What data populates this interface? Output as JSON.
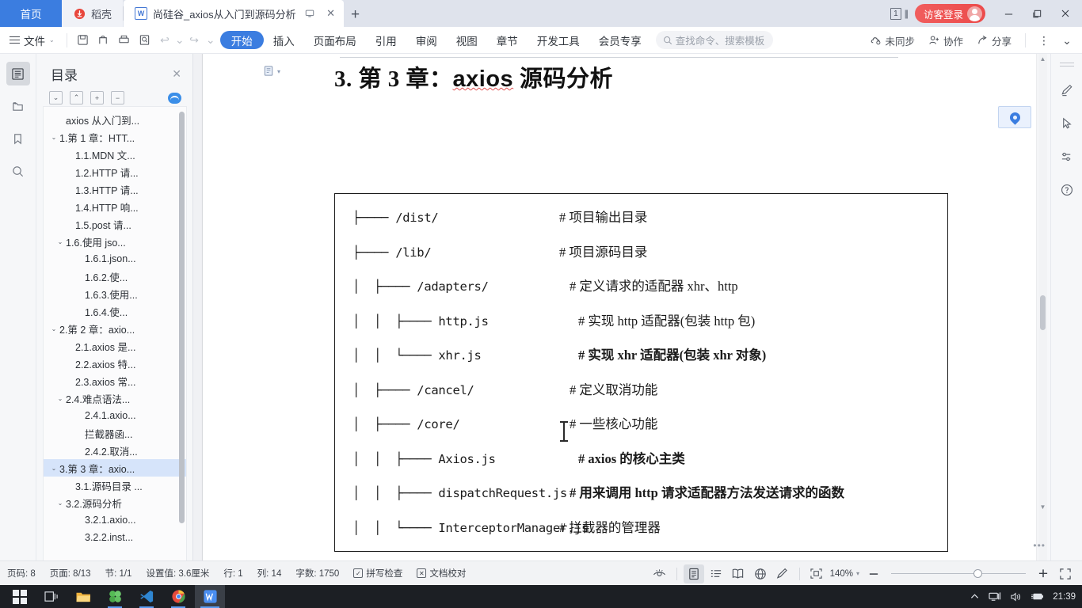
{
  "tabbar": {
    "home_label": "首页",
    "tabs": [
      {
        "label": "稻壳",
        "icon": "dock-icon"
      },
      {
        "label": "尚硅谷_axios从入门到源码分析",
        "icon": "wps-writer-icon"
      }
    ],
    "new_tab_label": "+",
    "page_count": "1",
    "login_label": "访客登录",
    "window_min": "—",
    "window_max": "❐",
    "window_close": "✕"
  },
  "ribbon": {
    "file_label": "文件",
    "quick_icons": [
      "save-icon",
      "print-preview-icon",
      "print-icon",
      "find-icon",
      "undo-icon",
      "redo-icon",
      "customize-icon"
    ],
    "tabs": [
      {
        "label": "开始",
        "selected": true
      },
      {
        "label": "插入",
        "selected": false
      },
      {
        "label": "页面布局",
        "selected": false
      },
      {
        "label": "引用",
        "selected": false
      },
      {
        "label": "审阅",
        "selected": false
      },
      {
        "label": "视图",
        "selected": false
      },
      {
        "label": "章节",
        "selected": false
      },
      {
        "label": "开发工具",
        "selected": false
      },
      {
        "label": "会员专享",
        "selected": false
      }
    ],
    "search_placeholder": "查找命令、搜索模板",
    "sync_label": "未同步",
    "collab_label": "协作",
    "share_label": "分享",
    "more_label": "⋮",
    "collapse_label": "⌄"
  },
  "left_rail": [
    {
      "name": "outline-icon",
      "active": true
    },
    {
      "name": "folder-icon",
      "active": false
    },
    {
      "name": "bookmark-icon",
      "active": false
    },
    {
      "name": "search-icon",
      "active": false
    }
  ],
  "toc": {
    "title": "目录",
    "close_label": "✕",
    "tools": [
      "expand-down-icon",
      "collapse-up-icon",
      "plus-icon",
      "minus-icon",
      "sync-toc-icon"
    ],
    "items": [
      {
        "label": "axios 从入门到...",
        "indent": 1,
        "chevron": "",
        "selected": false
      },
      {
        "label": "1.第 1 章：HTT...",
        "indent": 0,
        "chevron": "⌄",
        "selected": false
      },
      {
        "label": "1.1.MDN 文...",
        "indent": 2,
        "chevron": "",
        "selected": false
      },
      {
        "label": "1.2.HTTP 请...",
        "indent": 2,
        "chevron": "",
        "selected": false
      },
      {
        "label": "1.3.HTTP 请...",
        "indent": 2,
        "chevron": "",
        "selected": false
      },
      {
        "label": "1.4.HTTP 响...",
        "indent": 2,
        "chevron": "",
        "selected": false
      },
      {
        "label": "1.5.post 请...",
        "indent": 2,
        "chevron": "",
        "selected": false
      },
      {
        "label": "1.6.使用 jso...",
        "indent": 1,
        "chevron": "⌄",
        "selected": false
      },
      {
        "label": "1.6.1.json...",
        "indent": 3,
        "chevron": "",
        "selected": false
      },
      {
        "label": "1.6.2.使...",
        "indent": 3,
        "chevron": "",
        "selected": false
      },
      {
        "label": "1.6.3.使用...",
        "indent": 3,
        "chevron": "",
        "selected": false
      },
      {
        "label": "1.6.4.使...",
        "indent": 3,
        "chevron": "",
        "selected": false
      },
      {
        "label": "2.第 2 章：axio...",
        "indent": 0,
        "chevron": "⌄",
        "selected": false
      },
      {
        "label": "2.1.axios 是...",
        "indent": 2,
        "chevron": "",
        "selected": false
      },
      {
        "label": "2.2.axios 特...",
        "indent": 2,
        "chevron": "",
        "selected": false
      },
      {
        "label": "2.3.axios 常...",
        "indent": 2,
        "chevron": "",
        "selected": false
      },
      {
        "label": "2.4.难点语法...",
        "indent": 1,
        "chevron": "⌄",
        "selected": false
      },
      {
        "label": "2.4.1.axio...",
        "indent": 3,
        "chevron": "",
        "selected": false
      },
      {
        "label": "拦截器函...",
        "indent": 3,
        "chevron": "",
        "selected": false
      },
      {
        "label": "2.4.2.取消...",
        "indent": 3,
        "chevron": "",
        "selected": false
      },
      {
        "label": "3.第 3 章：axio...",
        "indent": 0,
        "chevron": "⌄",
        "selected": true
      },
      {
        "label": "3.1.源码目录 ...",
        "indent": 2,
        "chevron": "",
        "selected": false
      },
      {
        "label": "3.2.源码分析",
        "indent": 1,
        "chevron": "⌄",
        "selected": false
      },
      {
        "label": "3.2.1.axio...",
        "indent": 3,
        "chevron": "",
        "selected": false
      },
      {
        "label": "3.2.2.inst...",
        "indent": 3,
        "chevron": "",
        "selected": false
      }
    ]
  },
  "document": {
    "heading": "3. 第 3 章：",
    "heading_en": "axios",
    "heading_tail": " 源码分析",
    "code_rows": [
      {
        "tree": "├──── /dist/",
        "comment": "# 项目输出目录",
        "bold": false,
        "cmt_indent": 0
      },
      {
        "tree": "├──── /lib/",
        "comment": "# 项目源码目录",
        "bold": false,
        "cmt_indent": 0
      },
      {
        "tree": "│  ├──── /adapters/",
        "comment": "# 定义请求的适配器 xhr、http",
        "bold": false,
        "cmt_indent": 1
      },
      {
        "tree": "│  │  ├──── http.js",
        "comment": "# 实现 http 适配器(包装 http 包)",
        "bold": false,
        "cmt_indent": 2
      },
      {
        "tree": "│  │  └──── xhr.js",
        "comment": "# 实现 xhr 适配器(包装 xhr 对象)",
        "bold": true,
        "cmt_indent": 2
      },
      {
        "tree": "│  ├──── /cancel/",
        "comment": "# 定义取消功能",
        "bold": false,
        "cmt_indent": 1
      },
      {
        "tree": "│  ├──── /core/",
        "comment": "# 一些核心功能",
        "bold": false,
        "cmt_indent": 1
      },
      {
        "tree": "│  │  ├──── Axios.js",
        "comment": "# axios 的核心主类",
        "bold": true,
        "cmt_indent": 2
      },
      {
        "tree": "│  │  ├──── dispatchRequest.js",
        "comment": "# 用来调用 http 请求适配器方法发送请求的函数",
        "bold": true,
        "cmt_indent": 1
      },
      {
        "tree": "│  │  └──── InterceptorManager.js",
        "comment": "# 拦截器的管理器",
        "bold": false,
        "cmt_indent": 0
      }
    ]
  },
  "right_rail": [
    {
      "name": "pen-highlight-icon"
    },
    {
      "name": "cursor-select-icon"
    },
    {
      "name": "settings-sliders-icon"
    },
    {
      "name": "help-circle-icon"
    }
  ],
  "status_bar": {
    "items": [
      {
        "label": "页码: 8"
      },
      {
        "label": "页面: 8/13"
      },
      {
        "label": "节: 1/1"
      },
      {
        "label": "设置值: 3.6厘米"
      },
      {
        "label": "行: 1"
      },
      {
        "label": "列: 14"
      },
      {
        "label": "字数: 1750"
      }
    ],
    "spellcheck_label": "拼写检查",
    "proofread_label": "文档校对",
    "view_icons": [
      "eye-icon",
      "page-view-icon",
      "outline-view-icon",
      "book-view-icon",
      "web-view-icon",
      "edit-view-icon"
    ],
    "fit_icon": "fit-page-icon",
    "zoom_level": "140%",
    "zoom_out": "—",
    "zoom_in": "+",
    "fullscreen_icon": "fullscreen-icon"
  },
  "taskbar": {
    "items": [
      "start-icon",
      "task-view-icon",
      "file-explorer-icon",
      "clover-app-icon",
      "vscode-icon",
      "chrome-icon",
      "wps-writer-icon"
    ],
    "tray": [
      "chevron-up-icon",
      "network-icon",
      "volume-icon",
      "battery-icon"
    ],
    "clock": "21:39"
  }
}
